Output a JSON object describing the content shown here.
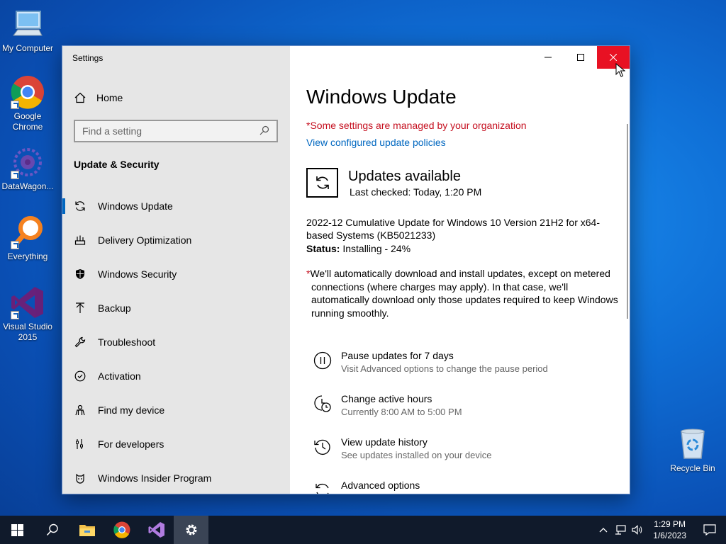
{
  "desktop": {
    "icons": [
      {
        "label": "My Computer"
      },
      {
        "label": "Google Chrome"
      },
      {
        "label": "DataWagon..."
      },
      {
        "label": "Everything"
      },
      {
        "label": "Visual Studio 2015"
      },
      {
        "label": "Recycle Bin"
      }
    ]
  },
  "window": {
    "title": "Settings",
    "sidebar": {
      "home": "Home",
      "search_placeholder": "Find a setting",
      "section": "Update & Security",
      "items": [
        {
          "label": "Windows Update",
          "icon": "refresh-icon",
          "active": true
        },
        {
          "label": "Delivery Optimization",
          "icon": "delivery-icon"
        },
        {
          "label": "Windows Security",
          "icon": "shield-icon"
        },
        {
          "label": "Backup",
          "icon": "backup-icon"
        },
        {
          "label": "Troubleshoot",
          "icon": "wrench-icon"
        },
        {
          "label": "Activation",
          "icon": "check-circle-icon"
        },
        {
          "label": "Find my device",
          "icon": "person-icon"
        },
        {
          "label": "For developers",
          "icon": "developer-icon"
        },
        {
          "label": "Windows Insider Program",
          "icon": "insider-icon"
        }
      ]
    },
    "content": {
      "title": "Windows Update",
      "managed_notice": "*Some settings are managed by your organization",
      "policies_link": "View configured update policies",
      "status_title": "Updates available",
      "last_checked": "Last checked: Today, 1:20 PM",
      "update_name": "2022-12 Cumulative Update for Windows 10 Version 21H2 for x64-based Systems (KB5021233)",
      "status_label": "Status:",
      "status_value": "Installing - 24%",
      "note_asterisk": "*",
      "note_text": "We'll automatically download and install updates, except on metered connections (where charges may apply). In that case, we'll automatically download only those updates required to keep Windows running smoothly.",
      "options": [
        {
          "title": "Pause updates for 7 days",
          "sub": "Visit Advanced options to change the pause period"
        },
        {
          "title": "Change active hours",
          "sub": "Currently 8:00 AM to 5:00 PM"
        },
        {
          "title": "View update history",
          "sub": "See updates installed on your device"
        },
        {
          "title": "Advanced options",
          "sub": ""
        }
      ]
    }
  },
  "taskbar": {
    "time": "1:29 PM",
    "date": "1/6/2023"
  },
  "colors": {
    "accent": "#0067c0",
    "warning": "#c50f1f",
    "close": "#e81123"
  }
}
